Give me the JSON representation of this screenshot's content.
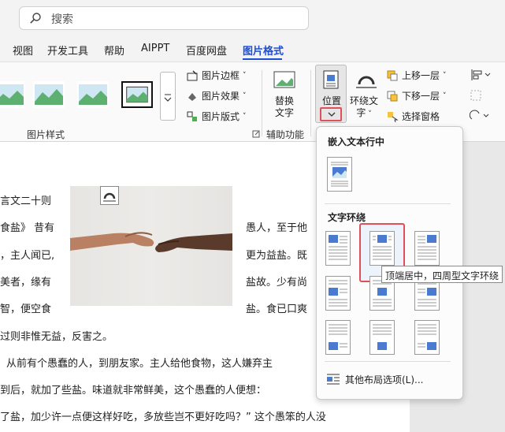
{
  "search": {
    "placeholder": "搜索"
  },
  "tabs": [
    {
      "label": "视图"
    },
    {
      "label": "开发工具"
    },
    {
      "label": "帮助"
    },
    {
      "label": "AIPPT"
    },
    {
      "label": "百度网盘"
    },
    {
      "label": "图片格式",
      "active": true
    }
  ],
  "ribbon": {
    "picture_border": "图片边框",
    "picture_effects": "图片效果",
    "picture_layout": "图片版式",
    "picture_styles_group": "图片样式",
    "alt_text_line1": "替换",
    "alt_text_line2": "文字",
    "accessibility_group": "辅助功能",
    "position": "位置",
    "wrap_text_line1": "环绕文",
    "wrap_text_line2": "字",
    "bring_forward": "上移一层",
    "send_backward": "下移一层",
    "selection_pane": "选择窗格"
  },
  "document": {
    "lines": [
      "言文二十则",
      "食盐》 昔有",
      "，主人闻已,",
      "美者，缘有",
      "智，便空食",
      "过则非惟无益，反害之。",
      "从前有个愚蠢的人，到朋友家。主人给他食物，这人嫌弃主",
      "到后，就加了些盐。味道就非常鲜美，这个愚蠢的人便想：",
      "了盐，加少许一点便这样好吃，多放些岂不更好吃吗？” 这个愚笨的人没"
    ],
    "right_lines": [
      "愚人，至于他",
      "更为益盐。既",
      "盐故。少有尚",
      "盐。食已口爽"
    ]
  },
  "dropdown": {
    "inline_header": "嵌入文本行中",
    "wrap_header": "文字环绕",
    "more_options": "其他布局选项(L)..."
  },
  "tooltip": {
    "text": "顶端居中，四周型文字环绕"
  },
  "colors": {
    "accent": "#1d4ed8",
    "highlight": "#e0505b"
  }
}
